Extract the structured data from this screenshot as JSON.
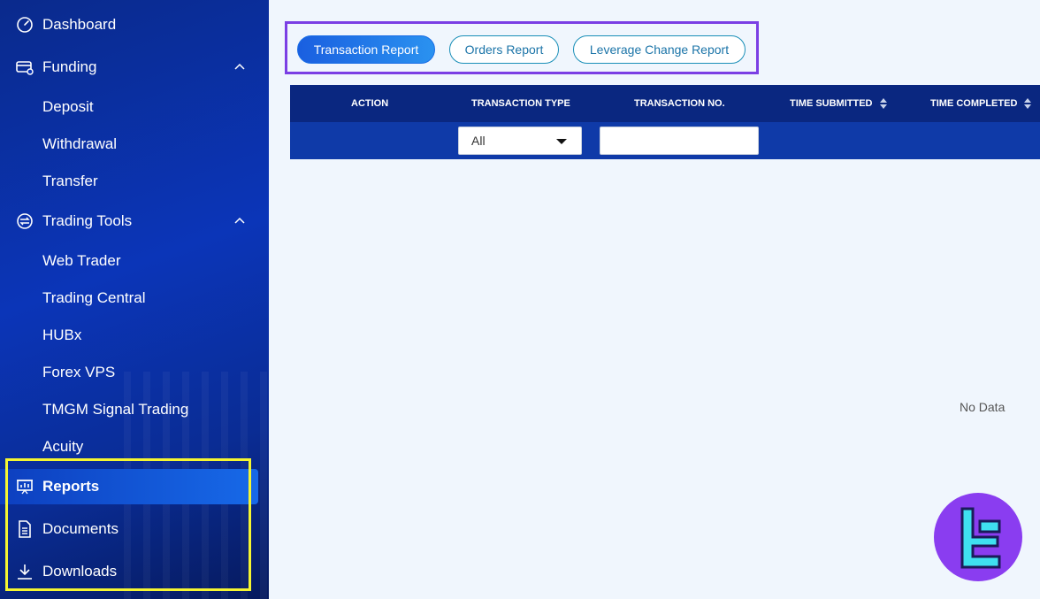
{
  "sidebar": {
    "items": [
      {
        "label": "Dashboard",
        "icon": "dashboard-gauge-icon"
      },
      {
        "label": "Funding",
        "icon": "funding-card-icon",
        "expanded": true
      },
      {
        "label": "Deposit"
      },
      {
        "label": "Withdrawal"
      },
      {
        "label": "Transfer"
      },
      {
        "label": "Trading Tools",
        "icon": "trading-tools-icon",
        "expanded": true
      },
      {
        "label": "Web Trader"
      },
      {
        "label": "Trading Central"
      },
      {
        "label": "HUBx"
      },
      {
        "label": "Forex VPS"
      },
      {
        "label": "TMGM Signal Trading"
      },
      {
        "label": "Acuity"
      },
      {
        "label": "Reports",
        "icon": "reports-presentation-icon",
        "active": true
      },
      {
        "label": "Documents",
        "icon": "document-icon"
      },
      {
        "label": "Downloads",
        "icon": "download-icon"
      }
    ]
  },
  "tabs": [
    {
      "label": "Transaction Report",
      "active": true
    },
    {
      "label": "Orders Report"
    },
    {
      "label": "Leverage Change Report"
    }
  ],
  "table": {
    "columns": [
      "ACTION",
      "TRANSACTION TYPE",
      "TRANSACTION NO.",
      "TIME SUBMITTED",
      "TIME COMPLETED"
    ],
    "filters": {
      "transaction_type": "All",
      "transaction_no": ""
    },
    "empty_text": "No Data"
  },
  "colors": {
    "sidebar_bg": "#0b35b8",
    "active_item": "#1769e8",
    "tab_active": "#1a5fe0",
    "table_header": "#0a2780",
    "highlight_yellow": "#f5f531",
    "highlight_purple": "#7b3fe4",
    "logo_bg": "#8a3df0"
  }
}
